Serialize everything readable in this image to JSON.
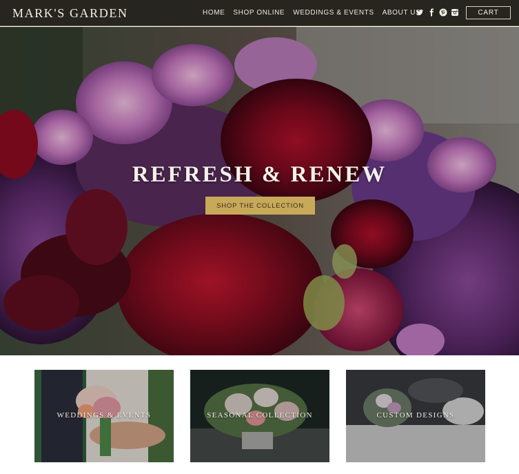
{
  "header": {
    "logo": "MARK'S GARDEN",
    "nav": [
      "HOME",
      "SHOP ONLINE",
      "WEDDINGS & EVENTS",
      "ABOUT US"
    ],
    "social_icons": [
      "twitter-icon",
      "facebook-icon",
      "pinterest-icon",
      "instagram-icon"
    ],
    "cart_label": "CART"
  },
  "hero": {
    "title": "REFRESH & RENEW",
    "cta_label": "SHOP THE COLLECTION"
  },
  "tiles": [
    {
      "label": "WEDDINGS & EVENTS"
    },
    {
      "label": "SEASONAL COLLECTION"
    },
    {
      "label": "CUSTOM DESIGNS"
    }
  ],
  "colors": {
    "header_bg": "#27251f",
    "accent_gold": "#c8a95a",
    "text_light": "#f3efe4"
  }
}
